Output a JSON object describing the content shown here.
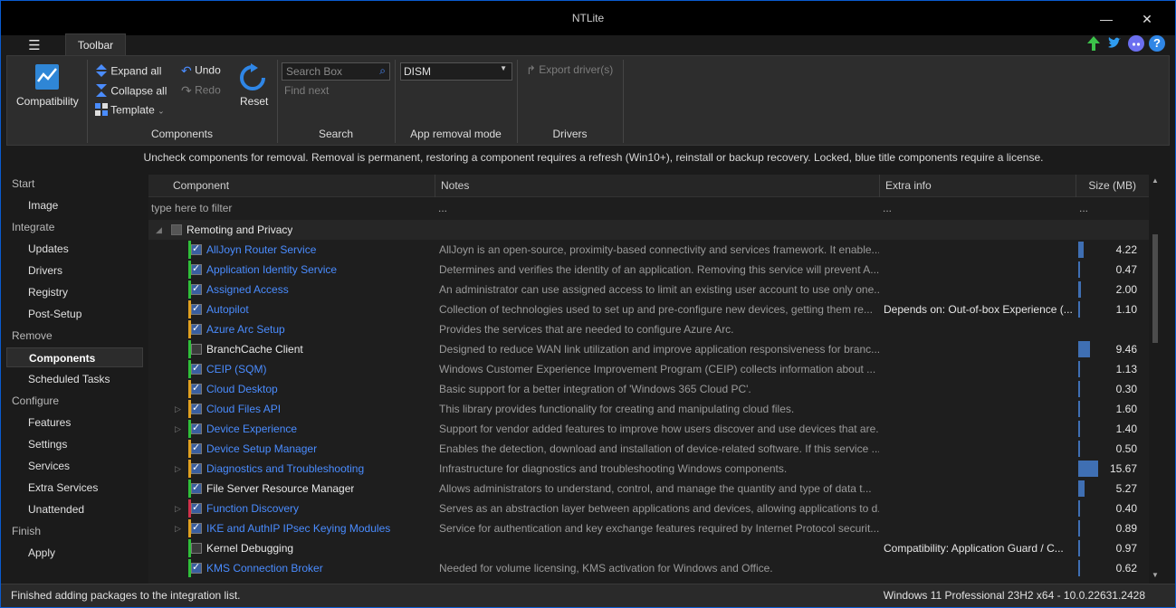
{
  "window": {
    "title": "NTLite",
    "minimize": "—",
    "maximize": "☐",
    "close": "✕"
  },
  "menu_icon": "☰",
  "tab": "Toolbar",
  "ribbon": {
    "compatibility": "Compatibility",
    "expand_all": "Expand all",
    "collapse_all": "Collapse all",
    "template": "Template",
    "undo": "Undo",
    "redo": "Redo",
    "reset": "Reset",
    "search_placeholder": "Search Box",
    "find_next": "Find next",
    "dism": "DISM",
    "export_drivers": "Export driver(s)",
    "groups": {
      "components": "Components",
      "search": "Search",
      "app_removal": "App removal mode",
      "drivers": "Drivers"
    }
  },
  "info": "Uncheck components for removal. Removal is permanent, restoring a component requires a refresh (Win10+), reinstall or backup recovery. Locked, blue title components require a license.",
  "sidebar": [
    {
      "type": "head",
      "label": "Start"
    },
    {
      "type": "item",
      "label": "Image"
    },
    {
      "type": "head",
      "label": "Integrate"
    },
    {
      "type": "item",
      "label": "Updates"
    },
    {
      "type": "item",
      "label": "Drivers"
    },
    {
      "type": "item",
      "label": "Registry"
    },
    {
      "type": "item",
      "label": "Post-Setup"
    },
    {
      "type": "head",
      "label": "Remove"
    },
    {
      "type": "item",
      "label": "Components",
      "selected": true
    },
    {
      "type": "item",
      "label": "Scheduled Tasks"
    },
    {
      "type": "head",
      "label": "Configure"
    },
    {
      "type": "item",
      "label": "Features"
    },
    {
      "type": "item",
      "label": "Settings"
    },
    {
      "type": "item",
      "label": "Services"
    },
    {
      "type": "item",
      "label": "Extra Services"
    },
    {
      "type": "item",
      "label": "Unattended"
    },
    {
      "type": "head",
      "label": "Finish"
    },
    {
      "type": "item",
      "label": "Apply"
    }
  ],
  "grid": {
    "columns": [
      "Component",
      "Notes",
      "Extra info",
      "Size (MB)"
    ],
    "filter": {
      "component": "type here to filter",
      "notes": "...",
      "extra": "...",
      "size": "..."
    },
    "group": "Remoting and Privacy",
    "rows": [
      {
        "name": "AllJoyn Router Service",
        "blue": true,
        "checked": true,
        "bar": "#2fbf3a",
        "exp": false,
        "notes": "AllJoyn is an open-source, proximity-based connectivity and services framework. It enable...",
        "extra": "",
        "size": "4.22",
        "size_mb": 4.22
      },
      {
        "name": "Application Identity Service",
        "blue": true,
        "checked": true,
        "bar": "#2fbf3a",
        "exp": false,
        "notes": "Determines and verifies the identity of an application. Removing this service will prevent A...",
        "extra": "",
        "size": "0.47",
        "size_mb": 0.47
      },
      {
        "name": "Assigned Access",
        "blue": true,
        "checked": true,
        "bar": "#2fbf3a",
        "exp": false,
        "notes": "An administrator can use assigned access to limit an existing user account to use only one...",
        "extra": "",
        "size": "2.00",
        "size_mb": 2.0
      },
      {
        "name": "Autopilot",
        "blue": true,
        "checked": true,
        "bar": "#e0a020",
        "exp": false,
        "notes": "Collection of technologies used to set up and pre-configure new devices, getting them re...",
        "extra": "Depends on: Out-of-box Experience (...",
        "size": "1.10",
        "size_mb": 1.1
      },
      {
        "name": "Azure Arc Setup",
        "blue": true,
        "checked": true,
        "bar": "#e0a020",
        "exp": false,
        "notes": "Provides the services that are needed to configure Azure Arc.",
        "extra": "",
        "size": "",
        "size_mb": 0
      },
      {
        "name": "BranchCache Client",
        "blue": false,
        "checked": false,
        "bar": "#2fbf3a",
        "exp": false,
        "notes": "Designed to reduce WAN link utilization and improve application responsiveness for branc...",
        "extra": "",
        "size": "9.46",
        "size_mb": 9.46
      },
      {
        "name": "CEIP (SQM)",
        "blue": true,
        "checked": true,
        "bar": "#2fbf3a",
        "exp": false,
        "notes": "Windows Customer Experience Improvement Program (CEIP) collects information about ...",
        "extra": "",
        "size": "1.13",
        "size_mb": 1.13
      },
      {
        "name": "Cloud Desktop",
        "blue": true,
        "checked": true,
        "bar": "#e0a020",
        "exp": false,
        "notes": "Basic support for a better integration of 'Windows 365 Cloud PC'.",
        "extra": "",
        "size": "0.30",
        "size_mb": 0.3
      },
      {
        "name": "Cloud Files API",
        "blue": true,
        "checked": true,
        "bar": "#e0a020",
        "exp": true,
        "notes": "This library provides functionality for creating and manipulating cloud files.",
        "extra": "",
        "size": "1.60",
        "size_mb": 1.6
      },
      {
        "name": "Device Experience",
        "blue": true,
        "checked": true,
        "bar": "#2fbf3a",
        "exp": true,
        "notes": "Support for vendor added features to improve how users discover and use devices that are...",
        "extra": "",
        "size": "1.40",
        "size_mb": 1.4
      },
      {
        "name": "Device Setup Manager",
        "blue": true,
        "checked": true,
        "bar": "#e0a020",
        "exp": false,
        "notes": "Enables the detection, download and installation of device-related software. If this service ...",
        "extra": "",
        "size": "0.50",
        "size_mb": 0.5
      },
      {
        "name": "Diagnostics and Troubleshooting",
        "blue": true,
        "checked": true,
        "bar": "#e0a020",
        "exp": true,
        "notes": "Infrastructure for diagnostics and troubleshooting Windows components.",
        "extra": "",
        "size": "15.67",
        "size_mb": 15.67
      },
      {
        "name": "File Server Resource Manager",
        "blue": false,
        "checked": true,
        "bar": "#2fbf3a",
        "exp": false,
        "notes": "Allows administrators to understand, control, and manage the quantity and type of data t...",
        "extra": "",
        "size": "5.27",
        "size_mb": 5.27
      },
      {
        "name": "Function Discovery",
        "blue": true,
        "checked": true,
        "bar": "#d0304a",
        "exp": true,
        "notes": "Serves as an abstraction layer between applications and devices, allowing applications to d...",
        "extra": "",
        "size": "0.40",
        "size_mb": 0.4
      },
      {
        "name": "IKE and AuthIP IPsec Keying Modules",
        "blue": true,
        "checked": true,
        "bar": "#e0a020",
        "exp": true,
        "notes": "Service for authentication and key exchange features required by Internet Protocol securit...",
        "extra": "",
        "size": "0.89",
        "size_mb": 0.89
      },
      {
        "name": "Kernel Debugging",
        "blue": false,
        "checked": false,
        "bar": "#2fbf3a",
        "exp": false,
        "notes": "",
        "extra": "Compatibility:  Application Guard / C...",
        "size": "0.97",
        "size_mb": 0.97
      },
      {
        "name": "KMS Connection Broker",
        "blue": true,
        "checked": true,
        "bar": "#2fbf3a",
        "exp": false,
        "notes": "Needed for volume licensing, KMS activation for Windows and Office.",
        "extra": "",
        "size": "0.62",
        "size_mb": 0.62
      }
    ]
  },
  "status": {
    "left": "Finished adding packages to the integration list.",
    "right": "Windows 11 Professional 23H2 x64 - 10.0.22631.2428"
  },
  "colors": {
    "blue_text": "#4a8cff",
    "size_bar": "#3f6fb3"
  }
}
